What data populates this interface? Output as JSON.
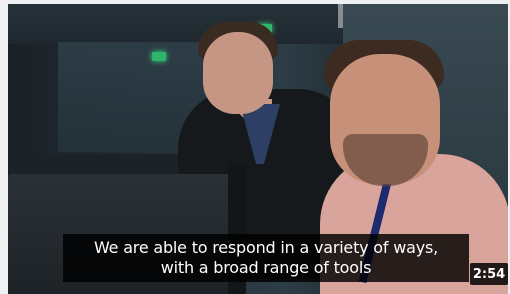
{
  "video": {
    "subtitle_line1": "We are able to respond in a variety of ways,",
    "subtitle_line2": "with a broad range of tools",
    "duration": "2:54"
  }
}
